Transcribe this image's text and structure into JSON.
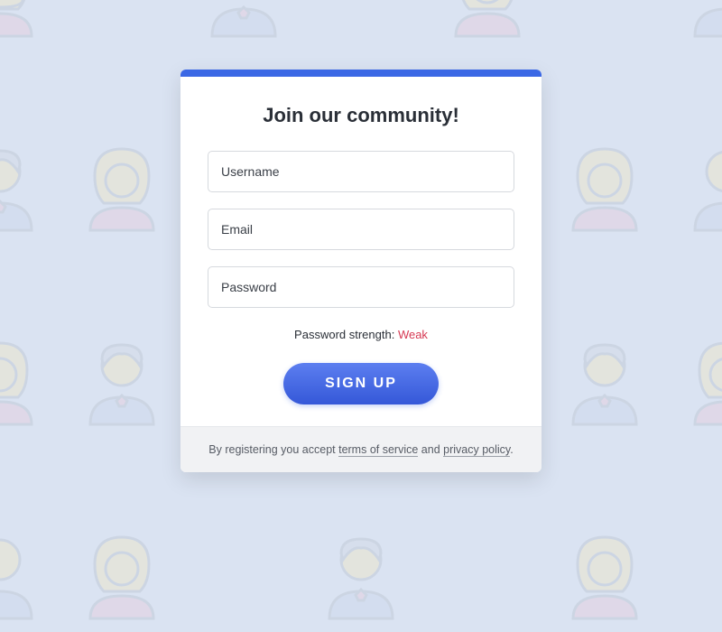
{
  "card": {
    "title": "Join our community!",
    "username_placeholder": "Username",
    "email_placeholder": "Email",
    "password_placeholder": "Password",
    "password_strength_label": "Password strength: ",
    "password_strength_value": "Weak",
    "signup_button": "SIGN UP",
    "footer_prefix": "By registering you accept ",
    "terms_link": "terms of service",
    "footer_and": " and ",
    "privacy_link": "privacy policy",
    "footer_suffix": "."
  },
  "colors": {
    "accent": "#3b68e5",
    "strength_weak": "#d63953"
  }
}
